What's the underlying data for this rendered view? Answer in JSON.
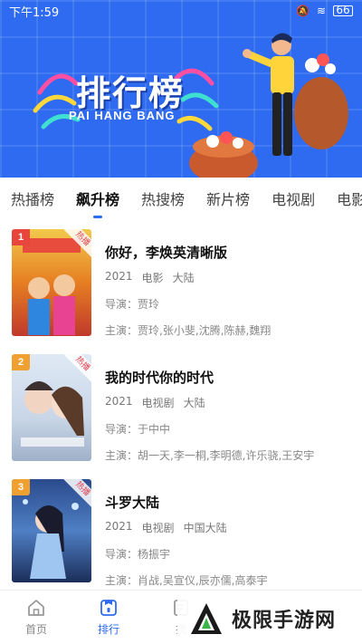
{
  "statusbar": {
    "time": "下午1:59",
    "battery": "66"
  },
  "banner": {
    "title": "排行榜",
    "subtitle": "PAI HANG BANG"
  },
  "tabs": [
    {
      "label": "热播榜"
    },
    {
      "label": "飙升榜",
      "active": true
    },
    {
      "label": "热搜榜"
    },
    {
      "label": "新片榜"
    },
    {
      "label": "电视剧"
    },
    {
      "label": "电影"
    }
  ],
  "list": [
    {
      "rank": "1",
      "badge": "热播",
      "poster_title": "你好，李焕英",
      "title": "你好，李焕英清晰版",
      "year": "2021",
      "genre": "电影",
      "region": "大陆",
      "director_label": "导演：",
      "director": "贾玲",
      "cast_label": "主演：",
      "cast": "贾玲,张小斐,沈腾,陈赫,魏翔",
      "rank_color": "#e8453c"
    },
    {
      "rank": "2",
      "badge": "热播",
      "poster_title": "我的时代你的时代",
      "title": "我的时代你的时代",
      "year": "2021",
      "genre": "电视剧",
      "region": "大陆",
      "director_label": "导演：",
      "director": "于中中",
      "cast_label": "主演：",
      "cast": "胡一天,李一桐,李明德,许乐骁,王安宇",
      "rank_color": "#f0a030"
    },
    {
      "rank": "3",
      "badge": "热播",
      "poster_title": "斗罗大陆",
      "title": "斗罗大陆",
      "year": "2021",
      "genre": "电视剧",
      "region": "中国大陆",
      "director_label": "导演：",
      "director": "杨振宇",
      "cast_label": "主演：",
      "cast": "肖战,吴宣仪,辰亦儒,高泰宇",
      "rank_color": "#f0a030"
    }
  ],
  "bottomnav": [
    {
      "label": "首页",
      "icon": "home-icon"
    },
    {
      "label": "排行",
      "icon": "ranking-icon",
      "active": true
    },
    {
      "label": "找",
      "icon": "find-icon"
    }
  ],
  "watermark": {
    "text": "极限手游网"
  },
  "colors": {
    "accent": "#2f6bf0",
    "rank1": "#e8453c",
    "rank_other": "#f0a030"
  }
}
